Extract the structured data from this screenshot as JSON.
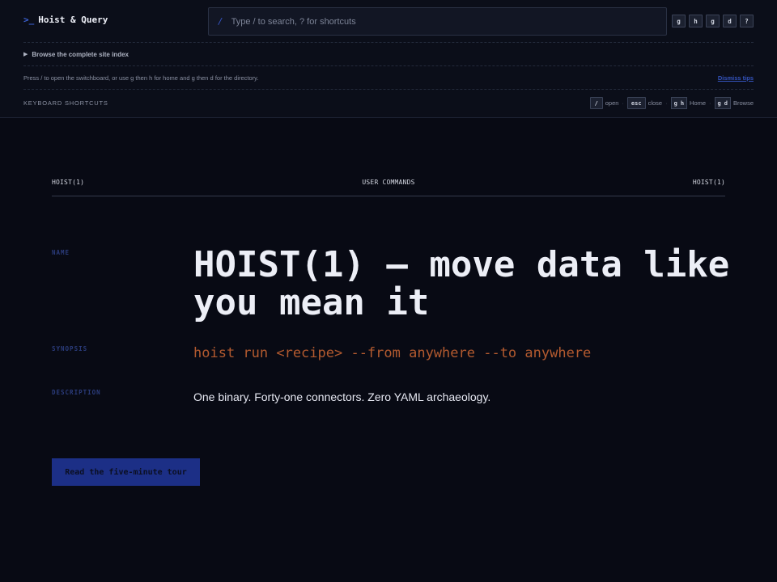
{
  "header": {
    "brand_prompt": ">_",
    "brand_name": "Hoist & Query",
    "search": {
      "slash": "/",
      "placeholder": "Type / to search, ? for shortcuts",
      "value": ""
    },
    "key_chips": [
      "g",
      "h",
      "g",
      "d",
      "?"
    ]
  },
  "site_index": {
    "label": "Browse the complete site index"
  },
  "tips": {
    "text": "Press / to open the switchboard, or use g then h for home and g then d for the directory.",
    "dismiss_label": "Dismiss tips"
  },
  "shortcuts": {
    "label": "KEYBOARD SHORTCUTS",
    "items": [
      {
        "keys": [
          "/"
        ],
        "action": "open"
      },
      {
        "keys": [
          "esc"
        ],
        "action": "close"
      },
      {
        "keys": [
          "g",
          "h"
        ],
        "action": "Home"
      },
      {
        "keys": [
          "g",
          "d"
        ],
        "action": "Browse"
      }
    ]
  },
  "manpage": {
    "header_left": "HOIST(1)",
    "header_center": "USER COMMANDS",
    "header_right": "HOIST(1)",
    "name_label": "NAME",
    "title": "HOIST(1) — move data like you mean it",
    "synopsis_label": "SYNOPSIS",
    "synopsis": "hoist run <recipe> --from anywhere --to anywhere",
    "description_label": "DESCRIPTION",
    "description": "One binary. Forty-one connectors. Zero YAML archaeology.",
    "cta_label": "Read the five-minute tour"
  },
  "colors": {
    "background": "#080a14",
    "accent": "#1c2f86",
    "synopsis": "#b35a2f",
    "section_label": "#2b3c7c"
  }
}
